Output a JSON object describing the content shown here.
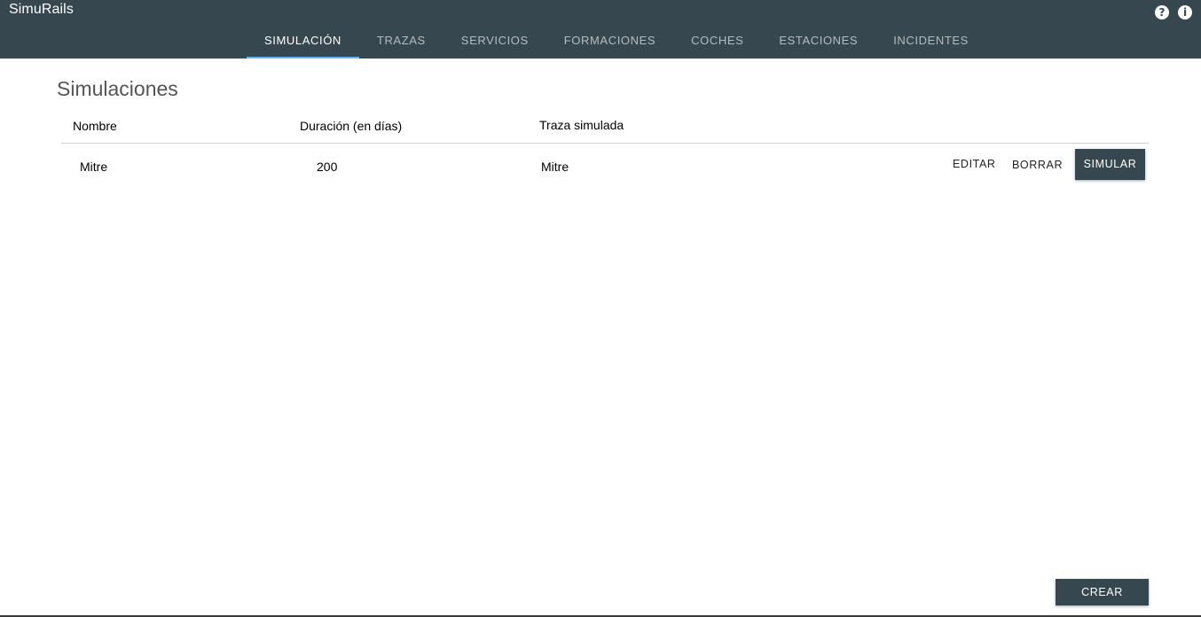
{
  "app": {
    "title": "SimuRails"
  },
  "header": {
    "icons": [
      {
        "name": "help-icon",
        "glyph": "?"
      },
      {
        "name": "info-icon",
        "glyph": "i"
      }
    ],
    "tabs": [
      {
        "label": "SIMULACIÓN",
        "active": true
      },
      {
        "label": "TRAZAS",
        "active": false
      },
      {
        "label": "SERVICIOS",
        "active": false
      },
      {
        "label": "FORMACIONES",
        "active": false
      },
      {
        "label": "COCHES",
        "active": false
      },
      {
        "label": "ESTACIONES",
        "active": false
      },
      {
        "label": "INCIDENTES",
        "active": false
      }
    ]
  },
  "main": {
    "title": "Simulaciones",
    "table": {
      "columns": [
        "Nombre",
        "Duración (en días)",
        "Traza simulada"
      ],
      "rows": [
        {
          "nombre": "Mitre",
          "duracion": "200",
          "traza": "Mitre"
        }
      ],
      "actions": {
        "edit": "EDITAR",
        "delete": "BORRAR",
        "simulate": "SIMULAR"
      }
    },
    "create_label": "CREAR"
  },
  "colors": {
    "appbar": "#37474f",
    "tab_indicator": "#64b5f6"
  }
}
